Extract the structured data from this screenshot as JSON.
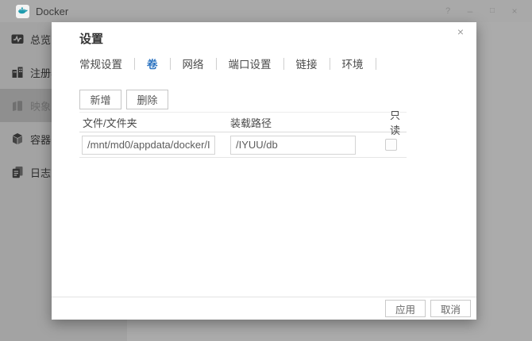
{
  "window": {
    "title": "Docker",
    "controls": {
      "help": "?",
      "minimize": "–",
      "maximize": "□",
      "close": "×"
    }
  },
  "sidebar": {
    "items": [
      {
        "label": "总览",
        "icon": "overview-icon",
        "selected": false
      },
      {
        "label": "注册表",
        "icon": "registry-icon",
        "selected": false
      },
      {
        "label": "映象",
        "icon": "images-icon",
        "selected": true
      },
      {
        "label": "容器",
        "icon": "containers-icon",
        "selected": false
      },
      {
        "label": "日志",
        "icon": "logs-icon",
        "selected": false
      }
    ]
  },
  "dialog": {
    "title": "设置",
    "close_glyph": "×",
    "tabs": [
      {
        "label": "常规设置",
        "selected": false
      },
      {
        "label": "卷",
        "selected": true
      },
      {
        "label": "网络",
        "selected": false
      },
      {
        "label": "端口设置",
        "selected": false
      },
      {
        "label": "链接",
        "selected": false
      },
      {
        "label": "环境",
        "selected": false
      }
    ],
    "toolbar": {
      "add_label": "新增",
      "delete_label": "删除"
    },
    "table": {
      "headers": [
        "文件/文件夹",
        "装载路径",
        "只读"
      ],
      "rows": [
        {
          "file_folder": "/mnt/md0/appdata/docker/I",
          "mount_path": "/IYUU/db",
          "readonly": false
        }
      ]
    },
    "footer": {
      "apply_label": "应用",
      "cancel_label": "取消"
    }
  },
  "colors": {
    "accent_blue": "#2a72c0",
    "overlay_gray": "#a9a9a9",
    "sidebar_gray": "#a3a3a3",
    "selected_item_gray": "#8f8f8f",
    "dialog_bg": "#ffffff"
  }
}
